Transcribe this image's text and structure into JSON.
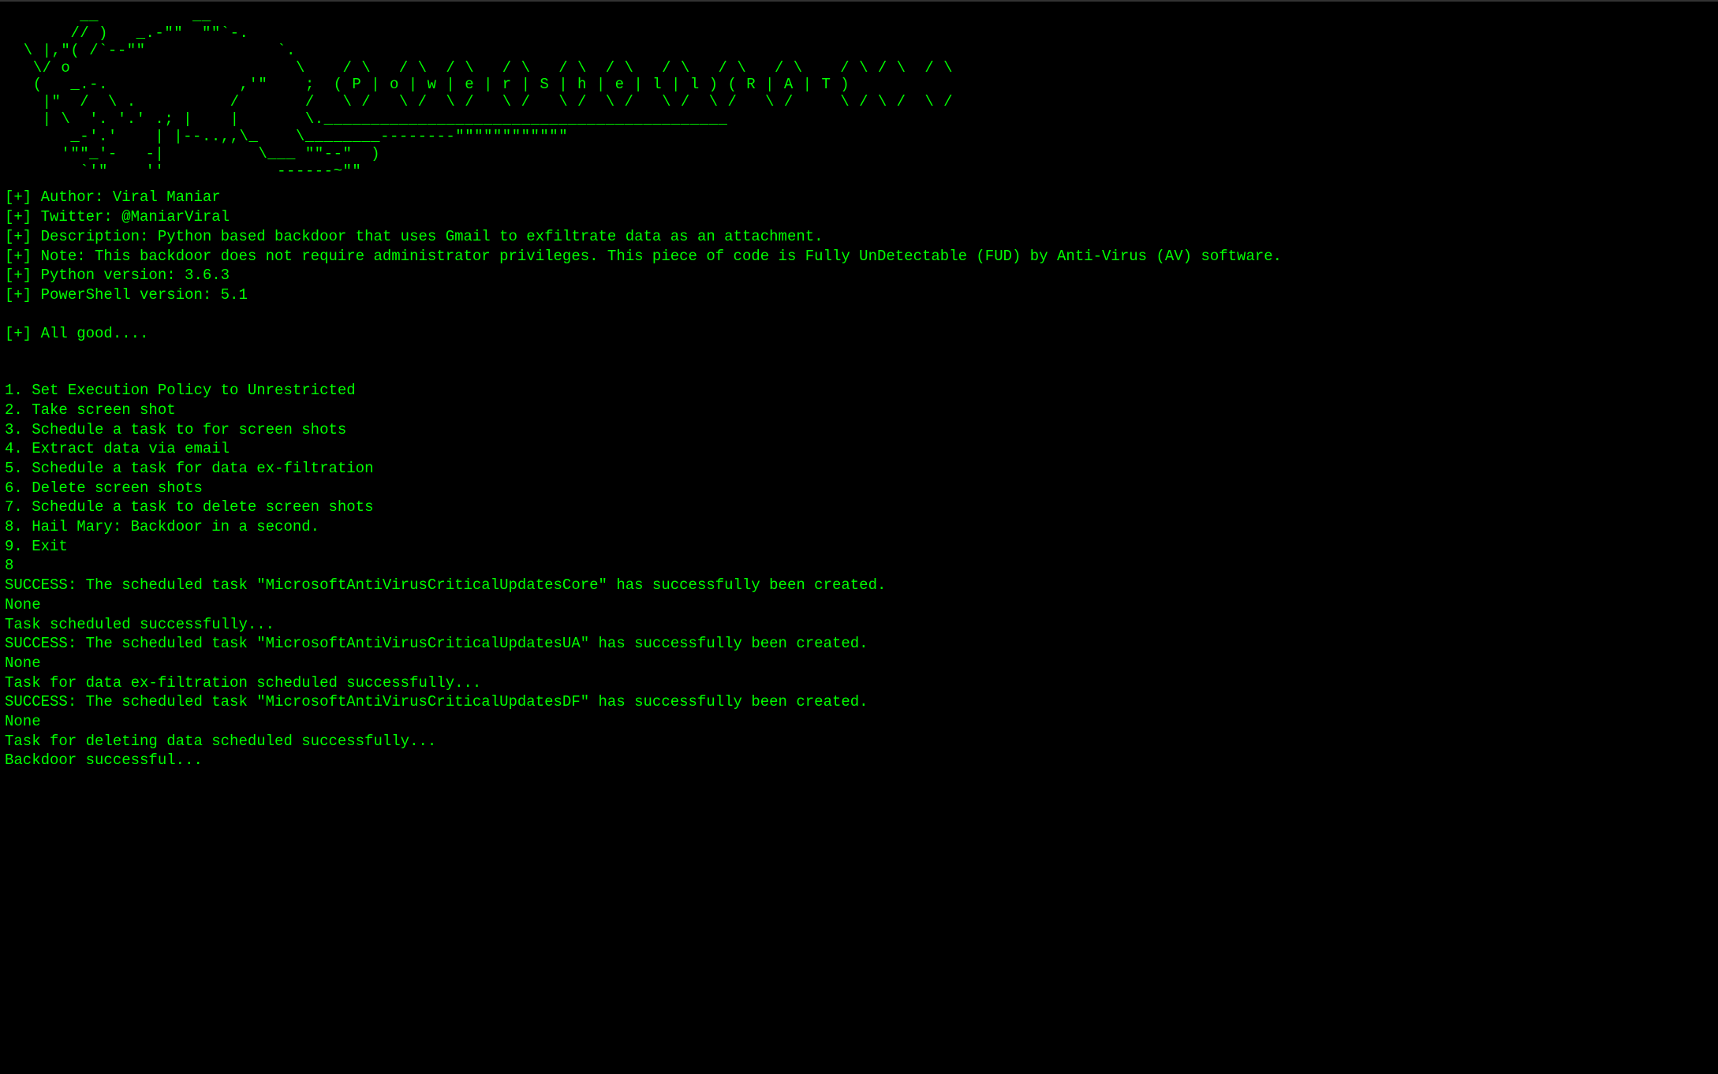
{
  "ascii_art": "        __          __\n       // )   _.-\"\"  \"\"`-.\n  \\ |,\"( /`--\"\"              `.\n   \\/ o                        \\    / \\   / \\  / \\   / \\   / \\  / \\   / \\   / \\   / \\    / \\ / \\  / \\\n   (   _.-.              ,'\"    ;  ( P | o | w | e | r | S | h | e | l | l ) ( R | A | T )\n    |\"  /  \\ .          /       /   \\ /   \\ /  \\ /   \\ /   \\ /  \\ /   \\ /  \\ /   \\ /     \\ / \\ /  \\ /\n    | \\  '. '.' .; |    |       \\.___________________________________________\n       _-'.'    | |--..,,\\_    \\________--------\"\"\"\"\"\"\"\"\"\"\"\"\n      '\"\"_'-   -|          \\___ \"\"--\"  )\n        `'\"    ''            ------~\"\"",
  "info": {
    "author": "[+] Author: Viral Maniar",
    "twitter": "[+] Twitter: @ManiarViral",
    "description": "[+] Description: Python based backdoor that uses Gmail to exfiltrate data as an attachment.",
    "note": "[+] Note: This backdoor does not require administrator privileges. This piece of code is Fully UnDetectable (FUD) by Anti-Virus (AV) software.",
    "python_version": "[+] Python version: 3.6.3",
    "powershell_version": "[+] PowerShell version: 5.1",
    "all_good": "[+] All good...."
  },
  "menu": {
    "items": [
      "1. Set Execution Policy to Unrestricted",
      "2. Take screen shot",
      "3. Schedule a task to for screen shots",
      "4. Extract data via email",
      "5. Schedule a task for data ex-filtration",
      "6. Delete screen shots",
      "7. Schedule a task to delete screen shots",
      "8. Hail Mary: Backdoor in a second.",
      "9. Exit"
    ]
  },
  "user_input": "8",
  "output": {
    "lines": [
      "SUCCESS: The scheduled task \"MicrosoftAntiVirusCriticalUpdatesCore\" has successfully been created.",
      "None",
      "Task scheduled successfully...",
      "SUCCESS: The scheduled task \"MicrosoftAntiVirusCriticalUpdatesUA\" has successfully been created.",
      "None",
      "Task for data ex-filtration scheduled successfully...",
      "SUCCESS: The scheduled task \"MicrosoftAntiVirusCriticalUpdatesDF\" has successfully been created.",
      "None",
      "Task for deleting data scheduled successfully...",
      "Backdoor successful..."
    ]
  }
}
